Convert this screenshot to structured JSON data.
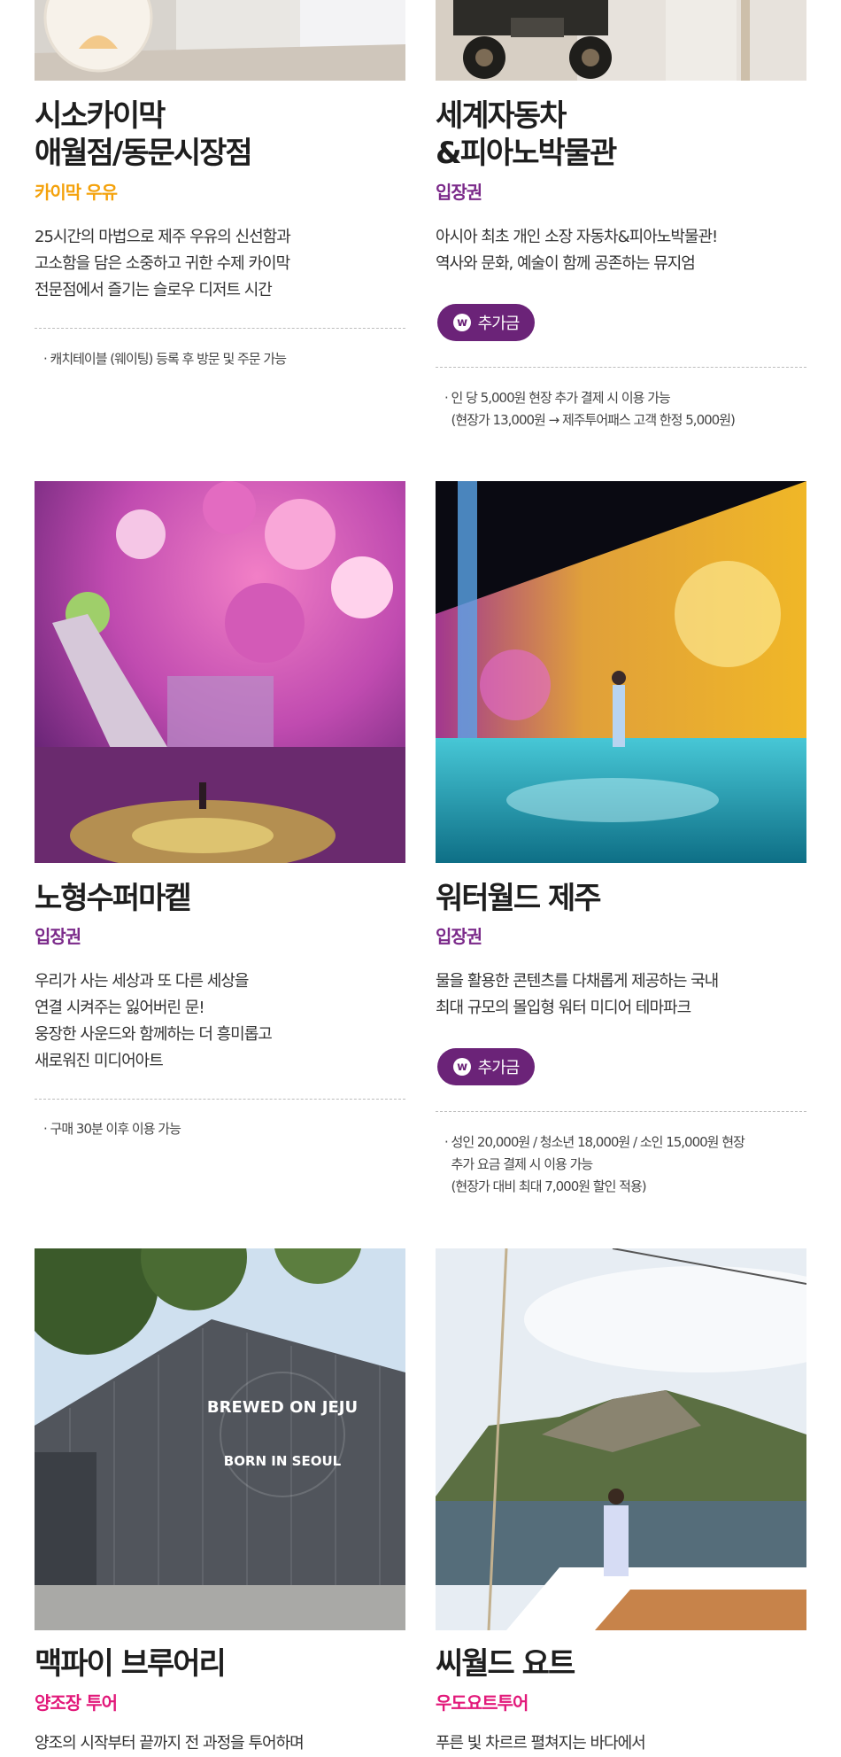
{
  "cards": [
    {
      "title_lines": [
        "시소카이막",
        "애월점/동문시장점"
      ],
      "subtitle": "카이막 우유",
      "subtitle_color": "#f4a20c",
      "desc_lines": [
        "25시간의 마법으로 제주 우유의 신선함과",
        "고소함을 담은 소중하고 귀한 수제 카이막",
        "전문점에서 즐기는 슬로우 디저트 시간"
      ],
      "note_lines": [
        "· 캐치테이블 (웨이팅) 등록 후 방문 및 주문 가능"
      ]
    },
    {
      "title_lines": [
        "세계자동차",
        "&피아노박물관"
      ],
      "subtitle": "입장권",
      "subtitle_color": "#7b2a8a",
      "desc_lines": [
        "아시아 최초 개인 소장 자동차&피아노박물관!",
        "역사와 문화, 예술이 함께 공존하는 뮤지엄"
      ],
      "badge": "추가금",
      "note_lines": [
        "· 인 당 5,000원 현장 추가 결제 시 이용 가능",
        "  (현장가 13,000원 → 제주투어패스 고객 한정 5,000원)"
      ]
    },
    {
      "title_lines": [
        "노형수퍼마켙"
      ],
      "subtitle": "입장권",
      "subtitle_color": "#7b2a8a",
      "desc_lines": [
        "우리가 사는 세상과 또 다른 세상을",
        "연결 시켜주는 잃어버린 문!",
        "웅장한 사운드와 함께하는 더 흥미롭고",
        "새로워진 미디어아트"
      ],
      "note_lines": [
        "· 구매 30분 이후 이용 가능"
      ]
    },
    {
      "title_lines": [
        "워터월드 제주"
      ],
      "subtitle": "입장권",
      "subtitle_color": "#7b2a8a",
      "desc_lines": [
        "물을 활용한 콘텐츠를 다채롭게 제공하는 국내",
        "최대 규모의 몰입형 워터 미디어 테마파크"
      ],
      "badge": "추가금",
      "note_lines": [
        "· 성인 20,000원 / 청소년 18,000원 / 소인 15,000원 현장",
        "  추가 요금 결제 시 이용 가능",
        "  (현장가 대비 최대 7,000원 할인 적용)"
      ]
    },
    {
      "title_lines": [
        "맥파이 브루어리"
      ],
      "subtitle": "양조장 투어",
      "subtitle_color": "#e2197a",
      "desc_lines": [
        "양조의 시작부터 끝까지 전 과정을 투어하며"
      ],
      "sign_text": [
        "BREWED ON JEJU",
        "BORN IN SEOUL"
      ]
    },
    {
      "title_lines": [
        "씨월드 요트"
      ],
      "subtitle": "우도요트투어",
      "subtitle_color": "#e2197a",
      "desc_lines": [
        "푸른 빛 차르르 펼쳐지는 바다에서"
      ]
    }
  ],
  "icons": {
    "badge_icon": "w-circle-icon"
  }
}
